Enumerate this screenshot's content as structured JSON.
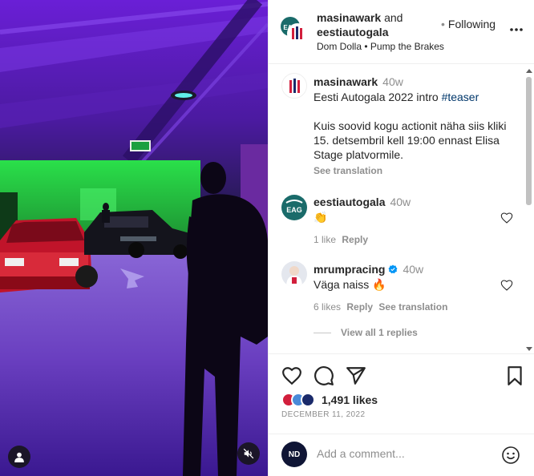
{
  "header": {
    "user1": "masinawark",
    "and": "and",
    "user2": "eestiautogala",
    "music": "Dom Dolla • Pump the Brakes",
    "dot": "•",
    "follow_label": "Following"
  },
  "caption": {
    "username": "masinawark",
    "time": "40w",
    "line1_text": "Eesti Autogala 2022 intro ",
    "hashtag": "#teaser",
    "body": "Kuis soovid kogu actionit näha siis kliki 15. detsembril kell 19:00 ennast Elisa Stage platvormile.",
    "see_translation": "See translation"
  },
  "comments": [
    {
      "username": "eestiautogala",
      "avatar_text": "EAG",
      "time": "40w",
      "text": "👏",
      "likes": "1 like",
      "reply": "Reply"
    },
    {
      "username": "mrumpracing",
      "time": "40w",
      "text": "Väga naiss 🔥",
      "likes": "6 likes",
      "reply": "Reply",
      "see_translation": "See translation",
      "view_replies": "View all 1 replies"
    }
  ],
  "post": {
    "likes": "1,491 likes",
    "date": "DECEMBER 11, 2022"
  },
  "add_comment": {
    "placeholder": "Add a comment...",
    "avatar_text": "ND"
  },
  "icons": {
    "like": "heart-icon",
    "comment": "comment-icon",
    "share": "paper-plane-icon",
    "save": "bookmark-icon",
    "more": "more-icon",
    "emoji": "emoji-icon",
    "mute": "muted-speaker-icon",
    "tagged_user": "user-icon",
    "verified": "verified-badge-icon"
  },
  "colors": {
    "link": "#00376b",
    "verified": "#0095f6",
    "muted_text": "#8e8e8e",
    "text": "#262626"
  }
}
